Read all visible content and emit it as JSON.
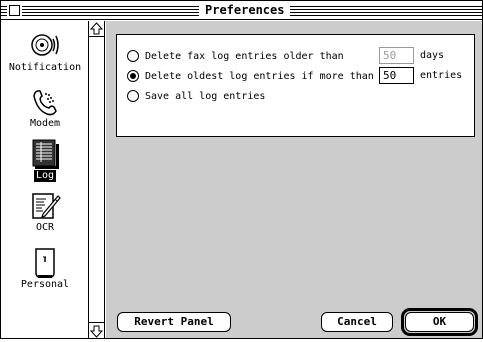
{
  "window": {
    "title": "Preferences"
  },
  "sidebar": {
    "items": [
      {
        "label": "Notification",
        "icon": "speaker-icon",
        "selected": false
      },
      {
        "label": "Modem",
        "icon": "phone-handset-icon",
        "selected": false
      },
      {
        "label": "Log",
        "icon": "log-document-icon",
        "selected": true
      },
      {
        "label": "OCR",
        "icon": "ocr-page-pencil-icon",
        "selected": false
      },
      {
        "label": "Personal",
        "icon": "personal-card-icon",
        "selected": false
      }
    ]
  },
  "log_options": {
    "delete_older": {
      "label": "Delete fax log entries older than",
      "value": "50",
      "unit": "days",
      "checked": false,
      "field_enabled": false
    },
    "delete_oldest": {
      "label": "Delete oldest log entries if more than",
      "value": "50",
      "unit": "entries",
      "checked": true,
      "field_enabled": true
    },
    "save_all": {
      "label": "Save all log entries",
      "checked": false
    }
  },
  "buttons": {
    "revert": "Revert Panel",
    "cancel": "Cancel",
    "ok": "OK"
  }
}
